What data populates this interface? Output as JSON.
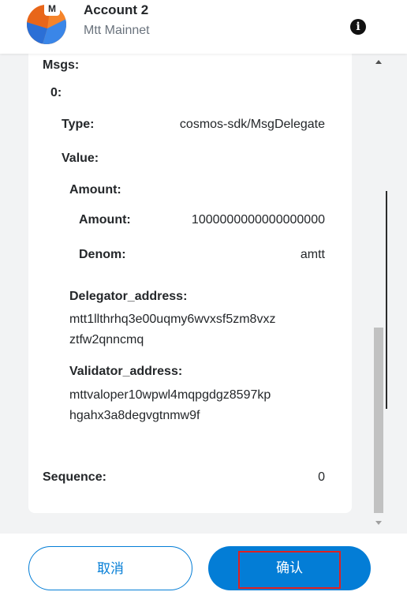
{
  "header": {
    "avatar_mark": "M",
    "account_name": "Account 2",
    "network_name": "Mtt Mainnet",
    "info_icon": "info-icon"
  },
  "details": {
    "msgs_label": "Msgs:",
    "index_label": "0:",
    "type_label": "Type:",
    "type_value": "cosmos-sdk/MsgDelegate",
    "value_label": "Value:",
    "amount_group_label": "Amount:",
    "amount_label": "Amount:",
    "amount_value": "1000000000000000000",
    "denom_label": "Denom:",
    "denom_value": "amtt",
    "delegator_label": "Delegator_address:",
    "delegator_line1": "mtt1llthrhq3e00uqmy6wvxsf5zm8vxz",
    "delegator_line2": "ztfw2qnncmq",
    "validator_label": "Validator_address:",
    "validator_line1": "mttvaloper10wpwl4mqpgdgz8597kp",
    "validator_line2": "hgahx3a8degvgtnmw9f",
    "sequence_label": "Sequence:",
    "sequence_value": "0"
  },
  "footer": {
    "cancel_label": "取消",
    "confirm_label": "确认"
  },
  "colors": {
    "accent": "#037dd6",
    "highlight": "#e02020",
    "avatar_orange": "#f5842a",
    "avatar_blue": "#2b6fd6"
  }
}
